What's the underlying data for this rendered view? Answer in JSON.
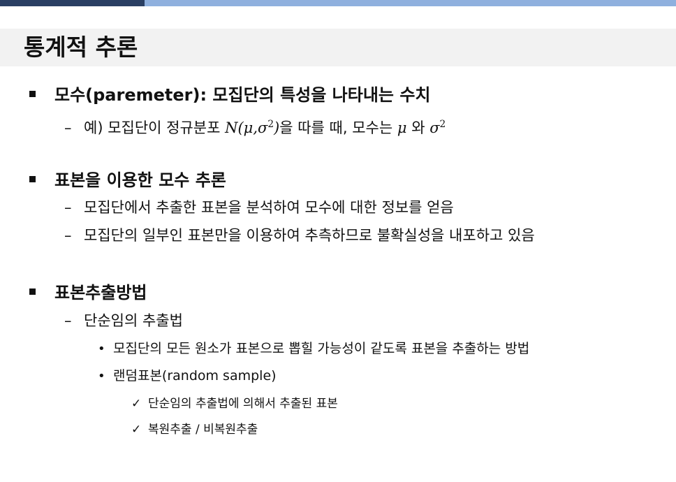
{
  "colors": {
    "top_bar_dark": "#2a3f63",
    "top_bar_light": "#8fb0de",
    "title_band_bg": "#f2f2f2",
    "text": "#111111"
  },
  "slide": {
    "title": "통계적 추론",
    "sections": [
      {
        "heading": "모수(paremeter): 모집단의 특성을 나타내는 수치",
        "example": {
          "dash": "–",
          "prefix": "예) 모집단이 정규분포 ",
          "math_dist": "N(μ,σ",
          "math_exp": "2",
          "math_close": ")",
          "middle": "을 따를 때, 모수는 ",
          "math_mu": "μ",
          "and": " 와 ",
          "math_sigma": "σ",
          "math_sigma_exp": "2"
        }
      },
      {
        "heading": "표본을 이용한 모수 추론",
        "items": [
          "모집단에서 추출한 표본을 분석하여 모수에 대한 정보를 얻음",
          "모집단의 일부인 표본만을 이용하여 추측하므로 불확실성을 내포하고 있음"
        ]
      },
      {
        "heading": "표본추출방법",
        "subheading": "단순임의 추출법",
        "bullets": [
          "모집단의 모든 원소가 표본으로 뽑힐 가능성이 같도록 표본을 추출하는 방법",
          "랜덤표본(random sample)"
        ],
        "checks": [
          "단순임의 추출법에 의해서 추출된 표본",
          "복원추출 / 비복원추출"
        ]
      }
    ],
    "glyphs": {
      "dash": "–",
      "dot": "•",
      "check": "✓"
    }
  }
}
